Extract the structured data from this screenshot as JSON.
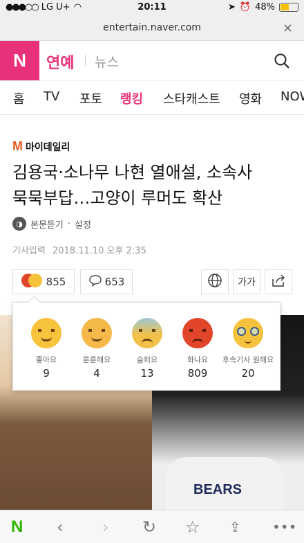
{
  "status": {
    "carrier": "LG U+",
    "time": "20:11",
    "battery": "48%"
  },
  "browser": {
    "url": "entertain.naver.com",
    "close": "×"
  },
  "header": {
    "logo": "N",
    "section": "연예",
    "sub": "뉴스"
  },
  "tabs": [
    {
      "label": "홈"
    },
    {
      "label": "TV"
    },
    {
      "label": "포토"
    },
    {
      "label": "랭킹"
    },
    {
      "label": "스타캐스트"
    },
    {
      "label": "영화"
    },
    {
      "label": "NOW"
    }
  ],
  "article": {
    "press": "마이데일리",
    "headline_line1": "김용국·소나무 나현 열애설, 소속사",
    "headline_line2": "묵묵부답…고양이 루머도 확산",
    "listen": "본문듣기",
    "settings": "설정",
    "date_label": "기사입력",
    "date": "2018.11.10 오후 2:35"
  },
  "actions": {
    "reaction_count": "855",
    "comment_count": "653",
    "font_size": "가가"
  },
  "reactions": [
    {
      "label": "좋아요",
      "count": "9",
      "icon": "like-face"
    },
    {
      "label": "훈훈해요",
      "count": "4",
      "icon": "warm-face"
    },
    {
      "label": "슬퍼요",
      "count": "13",
      "icon": "sad-face"
    },
    {
      "label": "화나요",
      "count": "809",
      "icon": "angry-face"
    },
    {
      "label": "후속기사 원해요",
      "count": "20",
      "icon": "want-followup-face"
    }
  ],
  "photo": {
    "jersey_text": "BEARS"
  },
  "colors": {
    "accent": "#e8317a",
    "naver_green": "#2db400"
  }
}
